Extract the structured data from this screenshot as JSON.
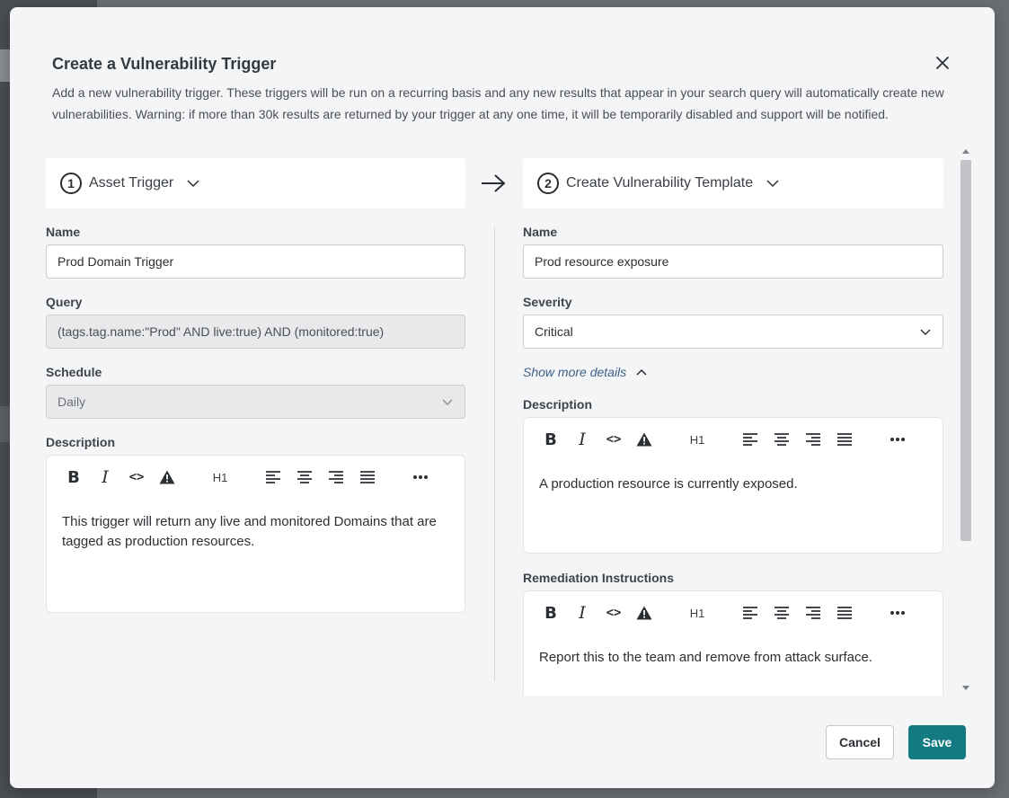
{
  "modal": {
    "title": "Create a Vulnerability Trigger",
    "description": "Add a new vulnerability trigger. These triggers will be run on a recurring basis and any new results that appear in your search query will automatically create new vulnerabilities. Warning: if more than 30k results are returned by your trigger at any one time, it will be temporarily disabled and support will be notified."
  },
  "steps": [
    {
      "number": "1",
      "label": "Asset Trigger"
    },
    {
      "number": "2",
      "label": "Create Vulnerability Template"
    }
  ],
  "asset_trigger": {
    "name_label": "Name",
    "name_value": "Prod Domain Trigger",
    "query_label": "Query",
    "query_value": "(tags.tag.name:\"Prod\" AND live:true) AND (monitored:true)",
    "schedule_label": "Schedule",
    "schedule_value": "Daily",
    "description_label": "Description",
    "description_text": "This trigger will return any live and monitored Domains that are tagged as production resources."
  },
  "template": {
    "name_label": "Name",
    "name_value": "Prod resource exposure",
    "severity_label": "Severity",
    "severity_value": "Critical",
    "show_more": "Show more details",
    "description_label": "Description",
    "description_text": "A production resource is currently exposed.",
    "remediation_label": "Remediation Instructions",
    "remediation_text": "Report this to the team and remove from attack surface."
  },
  "toolbar": {
    "bold": "B",
    "italic": "I",
    "code": "<>",
    "heading": "H1"
  },
  "buttons": {
    "cancel": "Cancel",
    "save": "Save"
  },
  "colors": {
    "accent": "#137a82",
    "link": "#3b5f87"
  }
}
